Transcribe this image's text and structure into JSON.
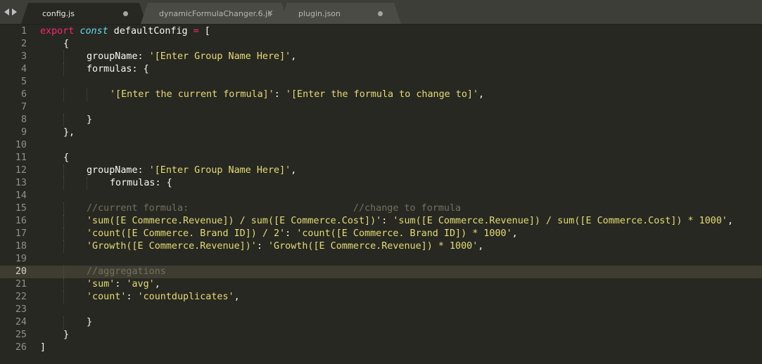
{
  "tabs": [
    {
      "label": "config.js",
      "active": true,
      "status": "modified-dot"
    },
    {
      "label": "dynamicFormulaChanger.6.js",
      "active": false,
      "status": "close"
    },
    {
      "label": "plugin.json",
      "active": false,
      "status": "modified-dot"
    }
  ],
  "icons": {
    "nav_back": "arrow-left-icon",
    "nav_forward": "arrow-right-icon",
    "close": "close-icon",
    "modified": "dot-icon"
  },
  "colors": {
    "background": "#272822",
    "keyword": "#f92672",
    "storage": "#66d9ef",
    "string": "#e6db74",
    "comment": "#75715e",
    "text": "#f8f8f2"
  },
  "current_line": 20,
  "editor": {
    "lines": [
      {
        "n": "1",
        "indent": 0,
        "tokens": [
          {
            "t": "kw",
            "v": "export"
          },
          {
            "t": "pl",
            "v": " "
          },
          {
            "t": "st",
            "v": "const"
          },
          {
            "t": "pl",
            "v": " defaultConfig "
          },
          {
            "t": "kw",
            "v": "="
          },
          {
            "t": "pl",
            "v": " ["
          }
        ]
      },
      {
        "n": "2",
        "indent": 1,
        "tokens": [
          {
            "t": "pl",
            "v": "{"
          }
        ]
      },
      {
        "n": "3",
        "indent": 2,
        "tokens": [
          {
            "t": "pl",
            "v": "groupName: "
          },
          {
            "t": "str",
            "v": "'[Enter Group Name Here]'"
          },
          {
            "t": "pl",
            "v": ","
          }
        ]
      },
      {
        "n": "4",
        "indent": 2,
        "tokens": [
          {
            "t": "pl",
            "v": "formulas: {"
          }
        ]
      },
      {
        "n": "5",
        "indent": 0,
        "tokens": []
      },
      {
        "n": "6",
        "indent": 3,
        "tokens": [
          {
            "t": "str",
            "v": "'[Enter the current formula]'"
          },
          {
            "t": "pl",
            "v": ": "
          },
          {
            "t": "str",
            "v": "'[Enter the formula to change to]'"
          },
          {
            "t": "pl",
            "v": ","
          }
        ]
      },
      {
        "n": "7",
        "indent": 0,
        "tokens": []
      },
      {
        "n": "8",
        "indent": 2,
        "tokens": [
          {
            "t": "pl",
            "v": "}"
          }
        ]
      },
      {
        "n": "9",
        "indent": 1,
        "tokens": [
          {
            "t": "pl",
            "v": "},"
          }
        ]
      },
      {
        "n": "10",
        "indent": 0,
        "tokens": []
      },
      {
        "n": "11",
        "indent": 1,
        "tokens": [
          {
            "t": "pl",
            "v": "{"
          }
        ]
      },
      {
        "n": "12",
        "indent": 2,
        "tokens": [
          {
            "t": "pl",
            "v": "groupName: "
          },
          {
            "t": "str",
            "v": "'[Enter Group Name Here]'"
          },
          {
            "t": "pl",
            "v": ","
          }
        ]
      },
      {
        "n": "13",
        "indent": 3,
        "tokens": [
          {
            "t": "pl",
            "v": "formulas: {"
          }
        ]
      },
      {
        "n": "14",
        "indent": 0,
        "tokens": []
      },
      {
        "n": "15",
        "indent": 2,
        "tokens": [
          {
            "t": "cm",
            "v": "//current formula:                             //change to formula"
          }
        ]
      },
      {
        "n": "16",
        "indent": 2,
        "tokens": [
          {
            "t": "str",
            "v": "'sum([E Commerce.Revenue]) / sum([E Commerce.Cost])'"
          },
          {
            "t": "pl",
            "v": ": "
          },
          {
            "t": "str",
            "v": "'sum([E Commerce.Revenue]) / sum([E Commerce.Cost]) * 1000'"
          },
          {
            "t": "pl",
            "v": ","
          }
        ]
      },
      {
        "n": "17",
        "indent": 2,
        "tokens": [
          {
            "t": "str",
            "v": "'count([E Commerce. Brand ID]) / 2'"
          },
          {
            "t": "pl",
            "v": ": "
          },
          {
            "t": "str",
            "v": "'count([E Commerce. Brand ID]) * 1000'"
          },
          {
            "t": "pl",
            "v": ","
          }
        ]
      },
      {
        "n": "18",
        "indent": 2,
        "tokens": [
          {
            "t": "str",
            "v": "'Growth([E Commerce.Revenue])'"
          },
          {
            "t": "pl",
            "v": ": "
          },
          {
            "t": "str",
            "v": "'Growth([E Commerce.Revenue]) * 1000'"
          },
          {
            "t": "pl",
            "v": ","
          }
        ]
      },
      {
        "n": "19",
        "indent": 0,
        "tokens": []
      },
      {
        "n": "20",
        "indent": 2,
        "tokens": [
          {
            "t": "cm",
            "v": "//aggregations"
          }
        ]
      },
      {
        "n": "21",
        "indent": 2,
        "tokens": [
          {
            "t": "str",
            "v": "'sum'"
          },
          {
            "t": "pl",
            "v": ": "
          },
          {
            "t": "str",
            "v": "'avg'"
          },
          {
            "t": "pl",
            "v": ","
          }
        ]
      },
      {
        "n": "22",
        "indent": 2,
        "tokens": [
          {
            "t": "str",
            "v": "'count'"
          },
          {
            "t": "pl",
            "v": ": "
          },
          {
            "t": "str",
            "v": "'countduplicates'"
          },
          {
            "t": "pl",
            "v": ","
          }
        ]
      },
      {
        "n": "23",
        "indent": 0,
        "tokens": []
      },
      {
        "n": "24",
        "indent": 2,
        "tokens": [
          {
            "t": "pl",
            "v": "}"
          }
        ]
      },
      {
        "n": "25",
        "indent": 1,
        "tokens": [
          {
            "t": "pl",
            "v": "}"
          }
        ]
      },
      {
        "n": "26",
        "indent": 0,
        "tokens": [
          {
            "t": "pl",
            "v": "]"
          }
        ]
      }
    ]
  }
}
